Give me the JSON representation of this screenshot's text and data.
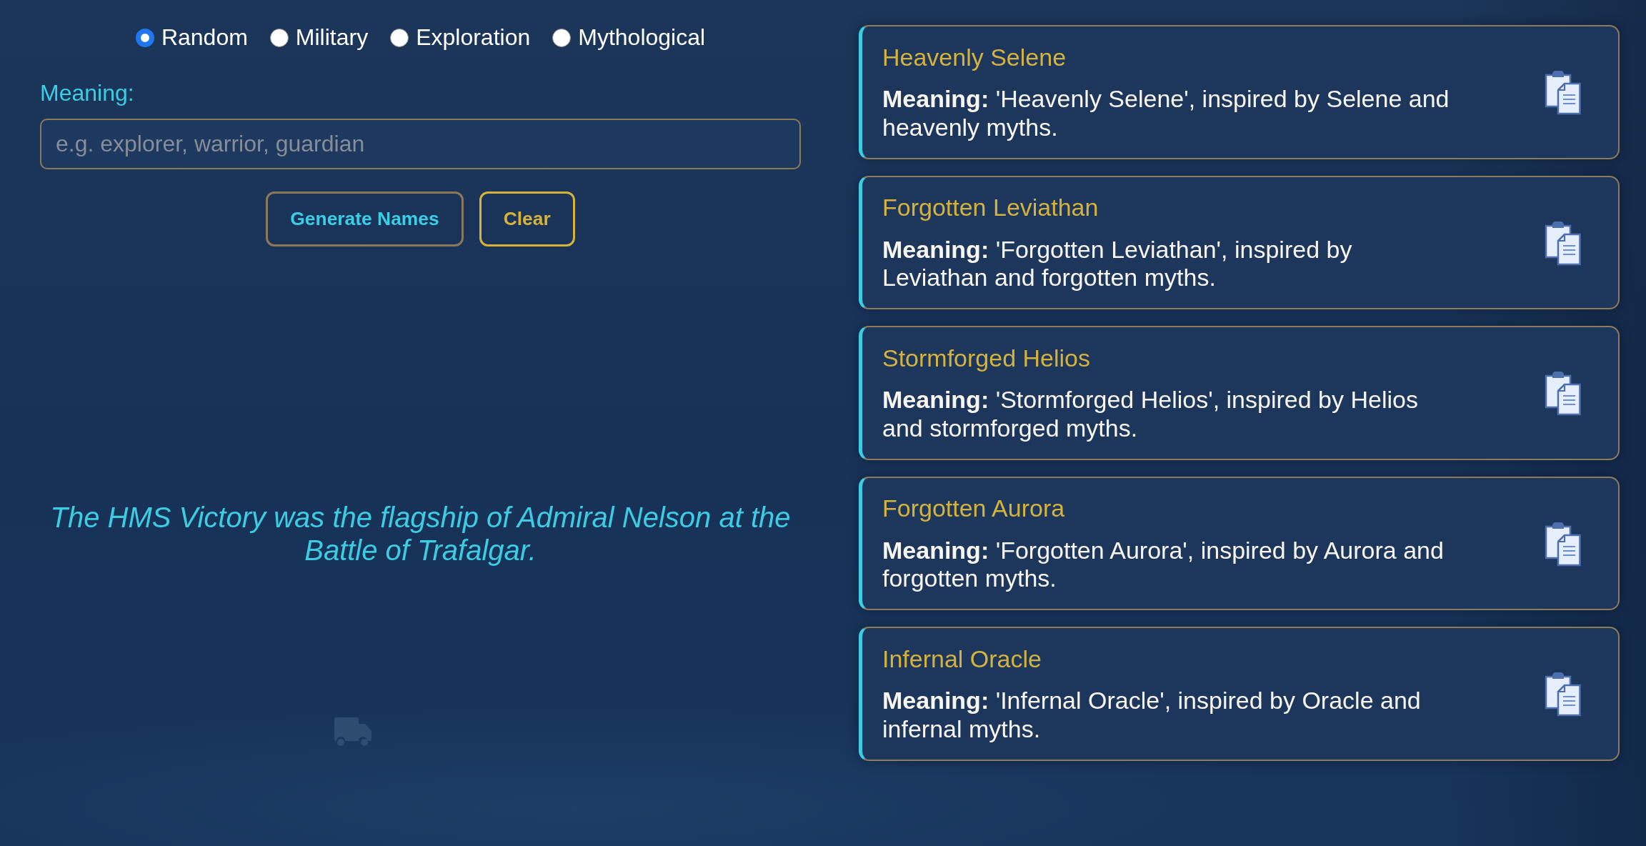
{
  "category_options": [
    {
      "label": "Random",
      "selected": true
    },
    {
      "label": "Military",
      "selected": false
    },
    {
      "label": "Exploration",
      "selected": false
    },
    {
      "label": "Mythological",
      "selected": false
    }
  ],
  "meaning_field": {
    "label": "Meaning:",
    "placeholder": "e.g. explorer, warrior, guardian"
  },
  "buttons": [
    {
      "label": "Generate Names",
      "kind": "generate"
    },
    {
      "label": "Clear",
      "kind": "clear"
    }
  ],
  "fact": "The HMS Victory was the flagship of Admiral Nelson at the Battle of Trafalgar.",
  "results": [
    {
      "name": "Heavenly Selene",
      "meaning": "**Meaning:** 'Heavenly Selene', inspired by Selene and heavenly myths."
    },
    {
      "name": "Forgotten Leviathan",
      "meaning": "**Meaning:** 'Forgotten Leviathan', inspired by Leviathan and forgotten myths."
    },
    {
      "name": "Stormforged Helios",
      "meaning": "**Meaning:** 'Stormforged Helios', inspired by Helios and stormforged myths."
    },
    {
      "name": "Forgotten Aurora",
      "meaning": "**Meaning:** 'Forgotten Aurora', inspired by Aurora and forgotten myths."
    },
    {
      "name": "Infernal Oracle",
      "meaning": "**Meaning:** 'Infernal Oracle', inspired by Oracle and infernal myths."
    }
  ]
}
